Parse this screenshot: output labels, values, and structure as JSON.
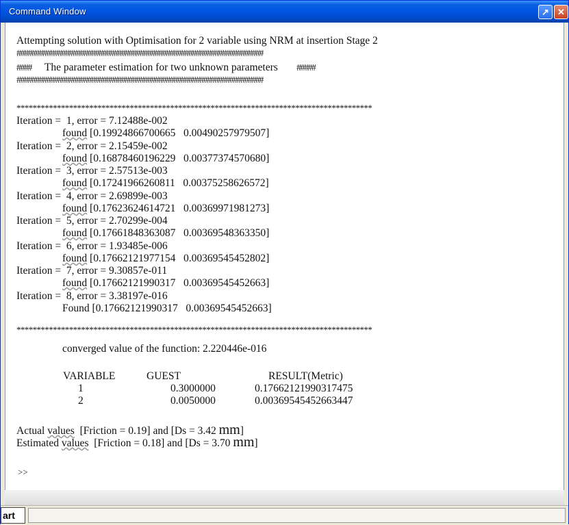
{
  "window": {
    "title": "Command Window",
    "undock_glyph": "↗",
    "close_glyph": "✕"
  },
  "console": {
    "line_attempt": "Attempting solution with Optimisation for 2 variable using NRM at insertion Stage 2",
    "hash_row": "##################################################################",
    "param_row_left": "####",
    "param_row_text": "The parameter estimation for two unknown parameters",
    "param_row_right": "#####",
    "stars_row": "****************************************************************************************",
    "iterations": [
      {
        "iter": "Iteration =  1, error = 7.12488e-002",
        "found_label": "found",
        "found_values": "[0.19924866700665   0.00490257979507]"
      },
      {
        "iter": "Iteration =  2, error = 2.15459e-002",
        "found_label": "found",
        "found_values": "[0.16878460196229   0.00377374570680]"
      },
      {
        "iter": "Iteration =  3, error = 2.57513e-003",
        "found_label": "found",
        "found_values": "[0.17241966260811   0.00375258626572]"
      },
      {
        "iter": "Iteration =  4, error = 2.69899e-003",
        "found_label": "found",
        "found_values": "[0.17623624614721   0.00369971981273]"
      },
      {
        "iter": "Iteration =  5, error = 2.70299e-004",
        "found_label": "found",
        "found_values": "[0.17661848363087   0.00369548363350]"
      },
      {
        "iter": "Iteration =  6, error = 1.93485e-006",
        "found_label": "found",
        "found_values": "[0.17662121977154   0.00369545452802]"
      },
      {
        "iter": "Iteration =  7, error = 9.30857e-011",
        "found_label": "found",
        "found_values": "[0.17662121990317   0.00369545452663]"
      },
      {
        "iter": "Iteration =  8, error = 3.38197e-016",
        "found_label": "Found",
        "found_values": "[0.17662121990317   0.00369545452663]"
      }
    ],
    "converged": "converged value of the function: 2.220446e-016",
    "table": {
      "headers": [
        "VARIABLE",
        "GUEST",
        "RESULT(Metric)"
      ],
      "rows": [
        [
          "1",
          "0.3000000",
          "0.17662121990317475"
        ],
        [
          "2",
          "0.0050000",
          "0.00369545452663447"
        ]
      ]
    },
    "actual_prefix": "Actual",
    "actual_label": "values",
    "actual_text": "[Friction = 0.19] and [Ds = 3.42",
    "actual_unit": "mm",
    "estimated_prefix": "Estimated",
    "estimated_label": "values",
    "estimated_text": "[Friction = 0.18] and [Ds = 3.70",
    "estimated_unit": "mm",
    "prompt": ">>"
  },
  "taskbar": {
    "start_label": "art"
  }
}
